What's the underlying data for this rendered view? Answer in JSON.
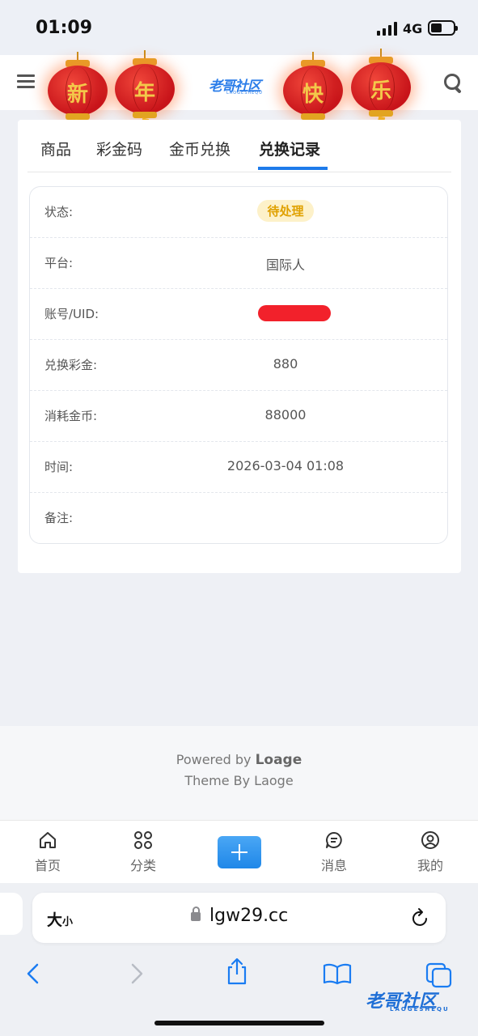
{
  "status_bar": {
    "time": "01:09",
    "network": "4G"
  },
  "header": {
    "logo_text": "老哥社区",
    "logo_sub": "LAOGESHEQU",
    "lanterns": [
      "新",
      "年",
      "快",
      "乐"
    ]
  },
  "tabs": [
    {
      "label": "商品"
    },
    {
      "label": "彩金码"
    },
    {
      "label": "金币兑换"
    },
    {
      "label": "兑换记录",
      "active": true
    }
  ],
  "record": {
    "status_label": "状态:",
    "status_value": "待处理",
    "platform_label": "平台:",
    "platform_value": "国际人",
    "account_label": "账号/UID:",
    "bonus_label": "兑换彩金:",
    "bonus_value": "880",
    "coins_label": "消耗金币:",
    "coins_value": "88000",
    "time_label": "时间:",
    "time_value": "2026-03-04 01:08",
    "note_label": "备注:",
    "note_value": ""
  },
  "footer": {
    "powered_prefix": "Powered by ",
    "powered_brand": "Loage",
    "theme": "Theme By Laoge"
  },
  "bottom_nav": [
    {
      "label": "首页",
      "icon": "home-icon"
    },
    {
      "label": "分类",
      "icon": "grid-icon"
    },
    {
      "label": "",
      "icon": "plus-icon"
    },
    {
      "label": "消息",
      "icon": "message-icon"
    },
    {
      "label": "我的",
      "icon": "user-icon"
    }
  ],
  "browser": {
    "aa_big": "大",
    "aa_small": "小",
    "url": "lgw29.cc"
  },
  "watermark": {
    "text": "老哥社区",
    "sub": "LAOGESHEQU"
  },
  "colors": {
    "accent": "#1e7bea",
    "badge_bg": "#fdf1c9",
    "badge_text": "#e0a100",
    "redaction": "#f2212b"
  }
}
